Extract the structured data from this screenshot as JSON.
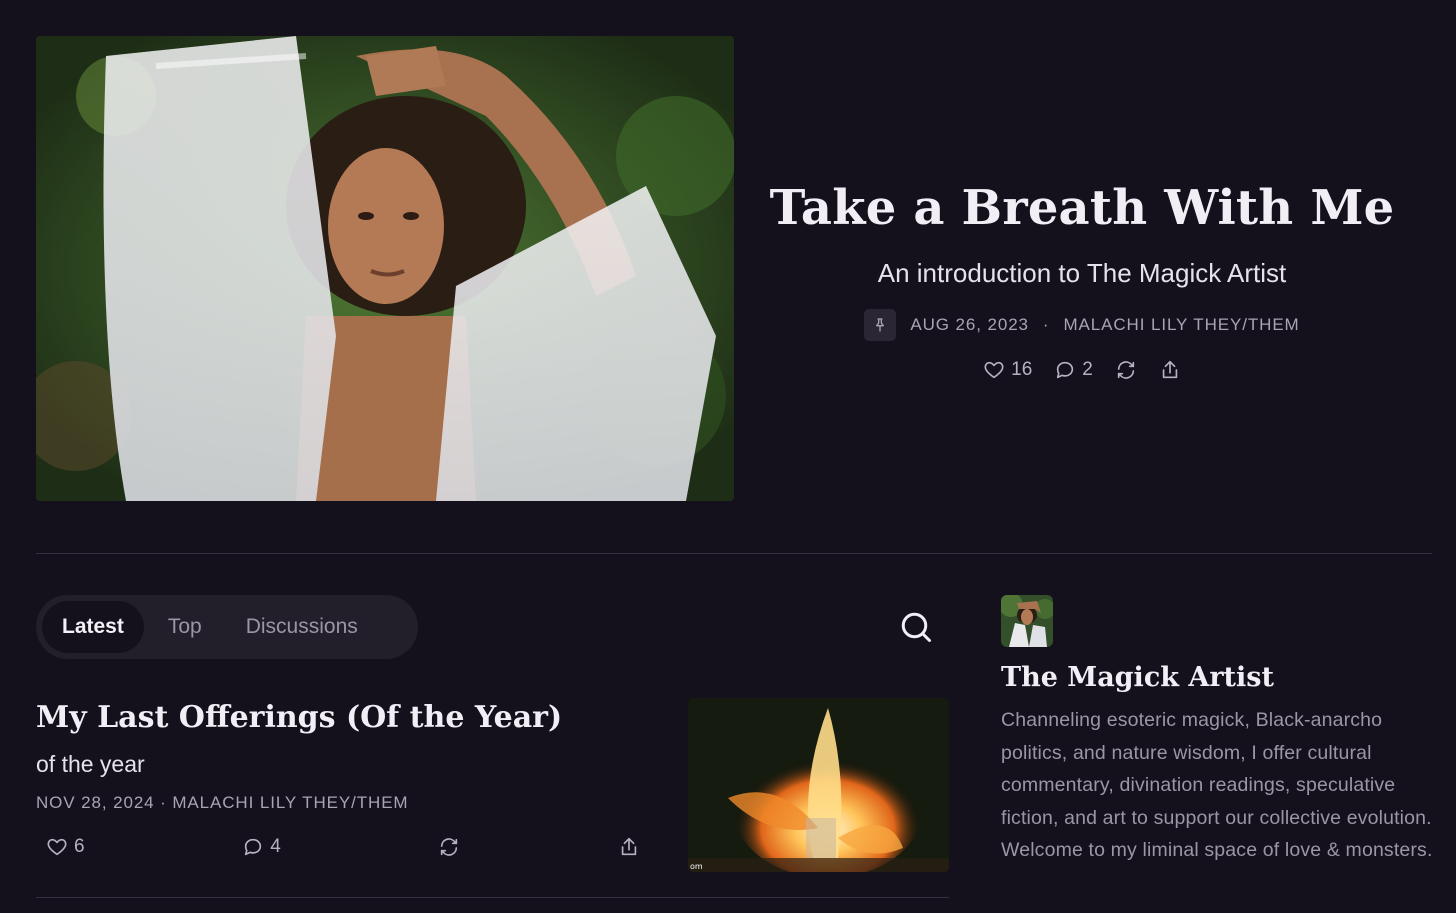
{
  "hero": {
    "image_alt": "Portrait of a person in a sheer white garment with arms raised above their head, standing in front of green foliage",
    "title": "Take a Breath With Me",
    "subtitle": "An introduction to The Magick Artist",
    "pinned_icon": "pin-icon",
    "date": "AUG 26, 2023",
    "separator": "·",
    "author": "MALACHI LILY THEY/THEM",
    "likes": "16",
    "comments": "2"
  },
  "tabs": [
    {
      "label": "Latest",
      "active": true
    },
    {
      "label": "Top",
      "active": false
    },
    {
      "label": "Discussions",
      "active": false
    }
  ],
  "post": {
    "title": "My Last Offerings (Of the Year)",
    "subtitle": "of the year",
    "date": "NOV 28, 2024",
    "separator": "·",
    "author": "MALACHI LILY THEY/THEM",
    "likes": "6",
    "comments": "4",
    "thumb_text": "om"
  },
  "publication": {
    "name": "The Magick Artist",
    "description": "Channeling esoteric magick, Black-anarcho politics, and nature wisdom, I offer cultural commentary, divination readings, speculative fiction, and art to support our collective evolution. Welcome to my liminal space of love & monsters."
  },
  "colors": {
    "background": "#14111c",
    "tab_bar": "#221f2b",
    "text_primary": "#f1eef5",
    "text_muted": "#a9a4b3"
  },
  "icons": [
    "pin-icon",
    "heart-icon",
    "comment-icon",
    "restack-icon",
    "share-icon",
    "search-icon"
  ]
}
